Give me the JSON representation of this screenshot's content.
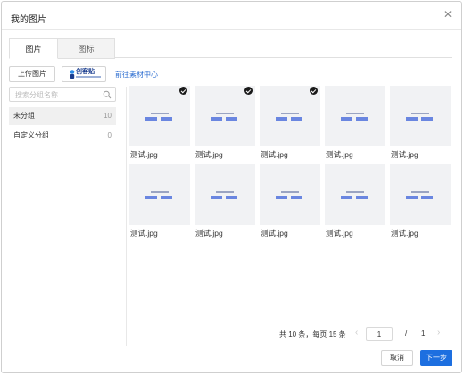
{
  "dialog": {
    "title": "我的图片",
    "close_icon": "close-icon"
  },
  "tabs": [
    {
      "label": "图片",
      "active": true
    },
    {
      "label": "图标",
      "active": false
    }
  ],
  "toolbar": {
    "upload_label": "上传图片",
    "brand_label": "创客贴",
    "brand_icon": "brand-logo-icon",
    "material_link": "前往素材中心"
  },
  "sidebar": {
    "search_placeholder": "搜索分组名称",
    "search_icon": "search-icon",
    "groups": [
      {
        "name": "未分组",
        "count": "10",
        "selected": true
      },
      {
        "name": "自定义分组",
        "count": "0",
        "selected": false
      }
    ]
  },
  "images": [
    {
      "name": "测试.jpg",
      "checked": true
    },
    {
      "name": "测试.jpg",
      "checked": true
    },
    {
      "name": "测试.jpg",
      "checked": true
    },
    {
      "name": "测试.jpg",
      "checked": false
    },
    {
      "name": "测试.jpg",
      "checked": false
    },
    {
      "name": "测试.jpg",
      "checked": false
    },
    {
      "name": "测试.jpg",
      "checked": false
    },
    {
      "name": "测试.jpg",
      "checked": false
    },
    {
      "name": "测试.jpg",
      "checked": false
    },
    {
      "name": "测试.jpg",
      "checked": false
    }
  ],
  "pagination": {
    "total_text": "共 10 条，每页 15 条",
    "current_page": "1",
    "separator": "/",
    "total_pages": "1"
  },
  "footer": {
    "cancel_label": "取消",
    "next_label": "下一步"
  },
  "colors": {
    "primary": "#1d6fe0",
    "link": "#2f6fd1",
    "check": "#1a1a1a"
  }
}
